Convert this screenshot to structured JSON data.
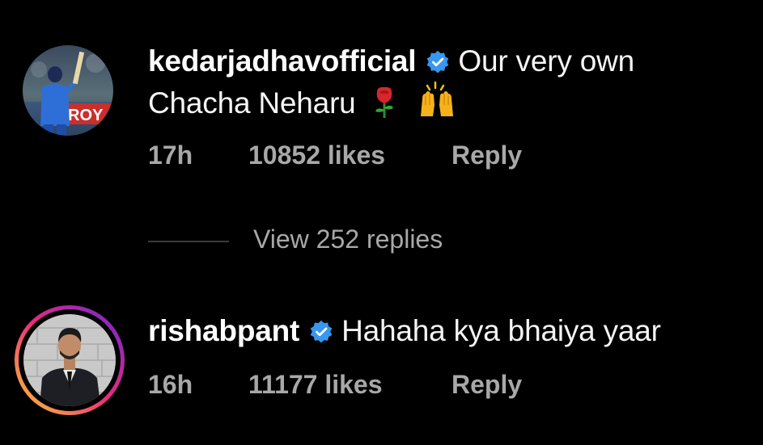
{
  "colors": {
    "background": "#000000",
    "text": "#f2f2f2",
    "meta_text": "#a8a8a8",
    "verified_blue": "#3897f0",
    "story_ring": [
      "#f9ce34",
      "#ee2a7b",
      "#6228d7"
    ]
  },
  "comments": [
    {
      "username": "kedarjadhavofficial",
      "verified": true,
      "verified_icon": "verified-badge-icon",
      "text_line1": "Our very own",
      "text_line2": "Chacha Neharu",
      "emojis": [
        "rose-emoji-icon",
        "raised-hands-emoji-icon"
      ],
      "time": "17h",
      "likes": "10852 likes",
      "reply_label": "Reply",
      "avatar_badge_text": "ROY"
    },
    {
      "username": "rishabpant",
      "verified": true,
      "verified_icon": "verified-badge-icon",
      "text": "Hahaha kya bhaiya yaar",
      "time": "16h",
      "likes": "11177 likes",
      "reply_label": "Reply",
      "has_story_ring": true
    }
  ],
  "view_replies": "View 252 replies"
}
